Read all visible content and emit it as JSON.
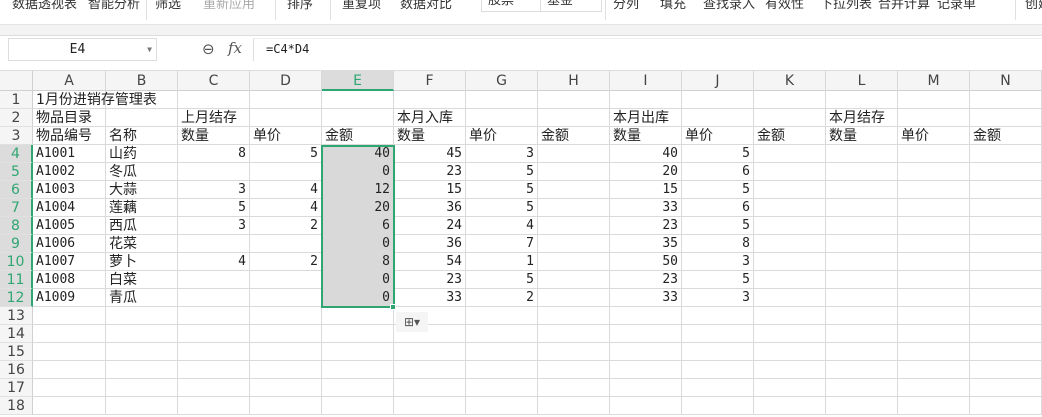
{
  "toolbar": {
    "items": [
      "数据透视表",
      "智能分析",
      "筛选",
      "重新应用",
      "排序",
      "重复项",
      "数据对比",
      "股票",
      "基金",
      "分列",
      "填充",
      "查找录入",
      "有效性",
      "下拉列表",
      "合并计算",
      "记录单",
      "创建"
    ]
  },
  "formula_bar": {
    "name_box": "E4",
    "formula": "=C4*D4",
    "fx": "fx"
  },
  "columns": [
    "A",
    "B",
    "C",
    "D",
    "E",
    "F",
    "G",
    "H",
    "I",
    "J",
    "K",
    "L",
    "M",
    "N"
  ],
  "selected_column": "E",
  "rows": [
    "1",
    "2",
    "3",
    "4",
    "5",
    "6",
    "7",
    "8",
    "9",
    "10",
    "11",
    "12",
    "13",
    "14",
    "15",
    "16",
    "17",
    "18"
  ],
  "cells": {
    "r1": {
      "A": "1月份进销存管理表"
    },
    "r2": {
      "A": "物品目录",
      "C": "上月结存",
      "F": "本月入库",
      "I": "本月出库",
      "L": "本月结存"
    },
    "r3": {
      "A": "物品编号",
      "B": "名称",
      "C": "数量",
      "D": "单价",
      "E": "金额",
      "F": "数量",
      "G": "单价",
      "H": "金额",
      "I": "数量",
      "J": "单价",
      "K": "金额",
      "L": "数量",
      "M": "单价",
      "N": "金额"
    }
  },
  "items": [
    {
      "code": "A1001",
      "name": "山药",
      "c": "8",
      "d": "5",
      "e": "40",
      "f": "45",
      "g": "3",
      "i": "40",
      "j": "5"
    },
    {
      "code": "A1002",
      "name": "冬瓜",
      "c": "",
      "d": "",
      "e": "0",
      "f": "23",
      "g": "5",
      "i": "20",
      "j": "6"
    },
    {
      "code": "A1003",
      "name": "大蒜",
      "c": "3",
      "d": "4",
      "e": "12",
      "f": "15",
      "g": "5",
      "i": "15",
      "j": "5"
    },
    {
      "code": "A1004",
      "name": "莲藕",
      "c": "5",
      "d": "4",
      "e": "20",
      "f": "36",
      "g": "5",
      "i": "33",
      "j": "6"
    },
    {
      "code": "A1005",
      "name": "西瓜",
      "c": "3",
      "d": "2",
      "e": "6",
      "f": "24",
      "g": "4",
      "i": "23",
      "j": "5"
    },
    {
      "code": "A1006",
      "name": "花菜",
      "c": "",
      "d": "",
      "e": "0",
      "f": "36",
      "g": "7",
      "i": "35",
      "j": "8"
    },
    {
      "code": "A1007",
      "name": "萝卜",
      "c": "4",
      "d": "2",
      "e": "8",
      "f": "54",
      "g": "1",
      "i": "50",
      "j": "3"
    },
    {
      "code": "A1008",
      "name": "白菜",
      "c": "",
      "d": "",
      "e": "0",
      "f": "23",
      "g": "5",
      "i": "23",
      "j": "5"
    },
    {
      "code": "A1009",
      "name": "青瓜",
      "c": "",
      "d": "",
      "e": "0",
      "f": "33",
      "g": "2",
      "i": "33",
      "j": "3"
    }
  ],
  "colors": {
    "accent": "#2fa672",
    "selection_fill": "#d9d9d9"
  }
}
